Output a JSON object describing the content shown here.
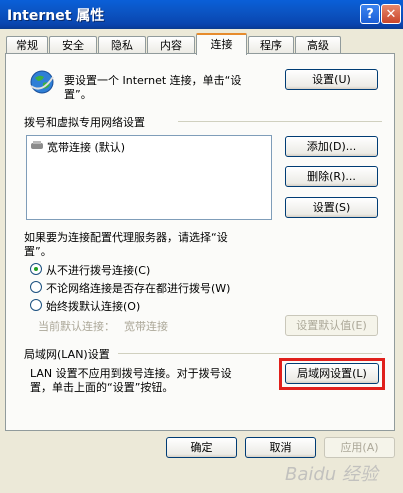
{
  "window": {
    "title": "Internet 属性",
    "help": "?",
    "close": "✕"
  },
  "tabs": [
    "常规",
    "安全",
    "隐私",
    "内容",
    "连接",
    "程序",
    "高级"
  ],
  "setup": {
    "text1": "要设置一个 Internet 连接，单击“设",
    "text2": "置”。",
    "button": "设置(U)"
  },
  "dialup": {
    "heading": "拨号和虚拟专用网络设置",
    "items": [
      "宽带连接 (默认)"
    ],
    "add": "添加(D)...",
    "remove": "删除(R)...",
    "settings": "设置(S)"
  },
  "proxy": {
    "text1": "如果要为连接配置代理服务器，请选择“设",
    "text2": "置”。"
  },
  "radios": [
    {
      "label": "从不进行拨号连接(C)",
      "checked": true
    },
    {
      "label": "不论网络连接是否存在都进行拨号(W)",
      "checked": false
    },
    {
      "label": "始终拨默认连接(O)",
      "checked": false
    }
  ],
  "current_default": {
    "label": "当前默认连接：",
    "value": "宽带连接",
    "button": "设置默认值(E)"
  },
  "lan": {
    "heading": "局域网(LAN)设置",
    "text1": "LAN 设置不应用到拨号连接。对于拨号设",
    "text2": "置，单击上面的“设置”按钮。",
    "button": "局域网设置(L)"
  },
  "footer": {
    "ok": "确定",
    "cancel": "取消",
    "apply": "应用(A)"
  },
  "watermark": "Baidu 经验",
  "colors": {
    "titlebar": "#0a5fd8",
    "highlight": "#e0201c",
    "active_tab_border": "#e68b2c",
    "background": "#ece9d8"
  }
}
